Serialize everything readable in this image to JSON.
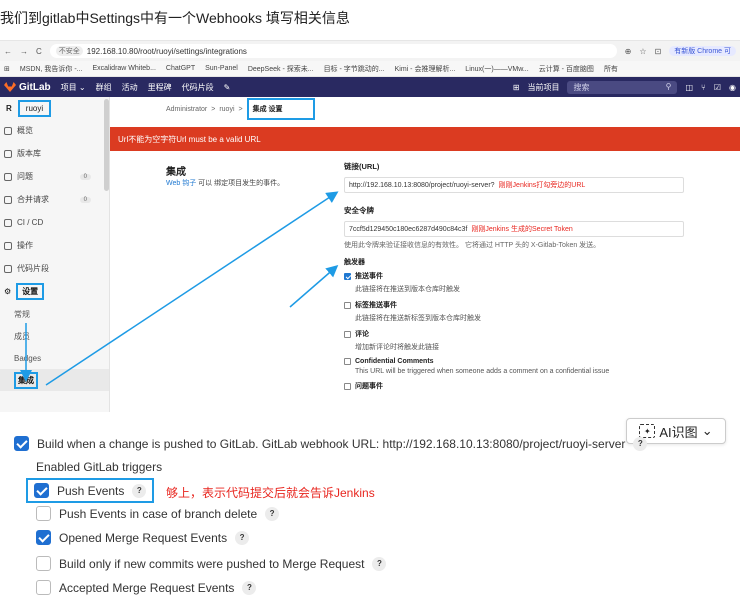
{
  "heading": "我们到gitlab中Settings中有一个Webhooks  填写相关信息",
  "browser": {
    "insecure_label": "不安全",
    "url": "192.168.10.80/root/ruoyi/settings/integrations",
    "chrome_label": "有新版 Chrome 可",
    "bookmarks": [
      "MSDN, 我告诉你 -...",
      "Excalidraw Whiteb...",
      "ChatGPT",
      "Sun-Panel",
      "DeepSeek - 探索未...",
      "目标 - 字节跳动的...",
      "Kimi - 会推理解析...",
      "Linux(一)——VMw...",
      "云计算 - 百度脑图"
    ],
    "all_bookmarks": "所有"
  },
  "gitlab_nav": {
    "brand": "GitLab",
    "items": [
      "项目 ⌄",
      "群组",
      "活动",
      "里程碑",
      "代码片段"
    ],
    "current_project": "当前项目",
    "search_placeholder": "搜索"
  },
  "sidebar": {
    "project_initial": "R",
    "project_name": "ruoyi",
    "items": [
      {
        "label": "概览",
        "count": ""
      },
      {
        "label": "版本库",
        "count": ""
      },
      {
        "label": "问题",
        "count": "0"
      },
      {
        "label": "合并请求",
        "count": "0"
      },
      {
        "label": "CI / CD",
        "count": ""
      },
      {
        "label": "操作",
        "count": ""
      },
      {
        "label": "代码片段",
        "count": ""
      }
    ],
    "settings_label": "设置",
    "sub_items": [
      "常规",
      "成员",
      "Badges"
    ],
    "active_sub": "集成"
  },
  "breadcrumb": {
    "admin": "Administrator",
    "sep": ">",
    "project": "ruoyi",
    "current": "集成 设置"
  },
  "alert": "Url不能为空字符Url must be a valid URL",
  "intro": {
    "title": "集成",
    "link": "Web 钩子",
    "desc_rest": " 可以 绑定项目发生的事件。"
  },
  "form": {
    "url_label": "链接(URL)",
    "url_value": "http://192.168.10.13:8080/project/ruoyi-server?",
    "url_note": "刚刚Jenkins打勾旁边的URL",
    "token_label": "安全令牌",
    "token_value": "7ccf5d129450c180ec6287d490c84c3f",
    "token_note": "刚刚Jenkins 生成的Secret Token",
    "token_help": "使用此令牌来验证接收信息的有效性。 它将通过 HTTP 头的 X-Gitlab-Token 发送。",
    "triggers_title": "触发器",
    "triggers": [
      {
        "label": "推送事件",
        "desc": "此链接将在推送到版本仓库时触发",
        "checked": true
      },
      {
        "label": "标签推送事件",
        "desc": "此链接将在推送新标签到版本仓库时触发",
        "checked": false
      },
      {
        "label": "评论",
        "desc": "增加新评论时将触发此链接",
        "checked": false
      },
      {
        "label": "Confidential Comments",
        "desc": "This URL will be triggered when someone adds a comment on a confidential issue",
        "checked": false
      },
      {
        "label": "问题事件",
        "desc": "",
        "checked": false
      }
    ]
  },
  "jenkins": {
    "build_trigger": "Build when a change is pushed to GitLab. GitLab webhook URL: http://192.168.10.13:8080/project/ruoyi-server",
    "enabled_triggers": "Enabled GitLab triggers",
    "push_events": "Push Events",
    "note": "够上，表示代码提交后就会告诉Jenkins",
    "push_branch_delete": "Push Events in case of branch delete",
    "opened_mr": "Opened Merge Request Events",
    "build_only_new_commits": "Build only if new commits were pushed to Merge Request",
    "accepted_mr": "Accepted Merge Request Events",
    "help_mark": "?"
  },
  "ai_button": {
    "label": "AI识图",
    "chevron": "⌄"
  },
  "colors": {
    "gitlab_nav": "#292961",
    "alert": "#db3b21",
    "highlight": "#1e9be5",
    "annotation": "#e8261f",
    "checkbox": "#1f6fd1"
  }
}
